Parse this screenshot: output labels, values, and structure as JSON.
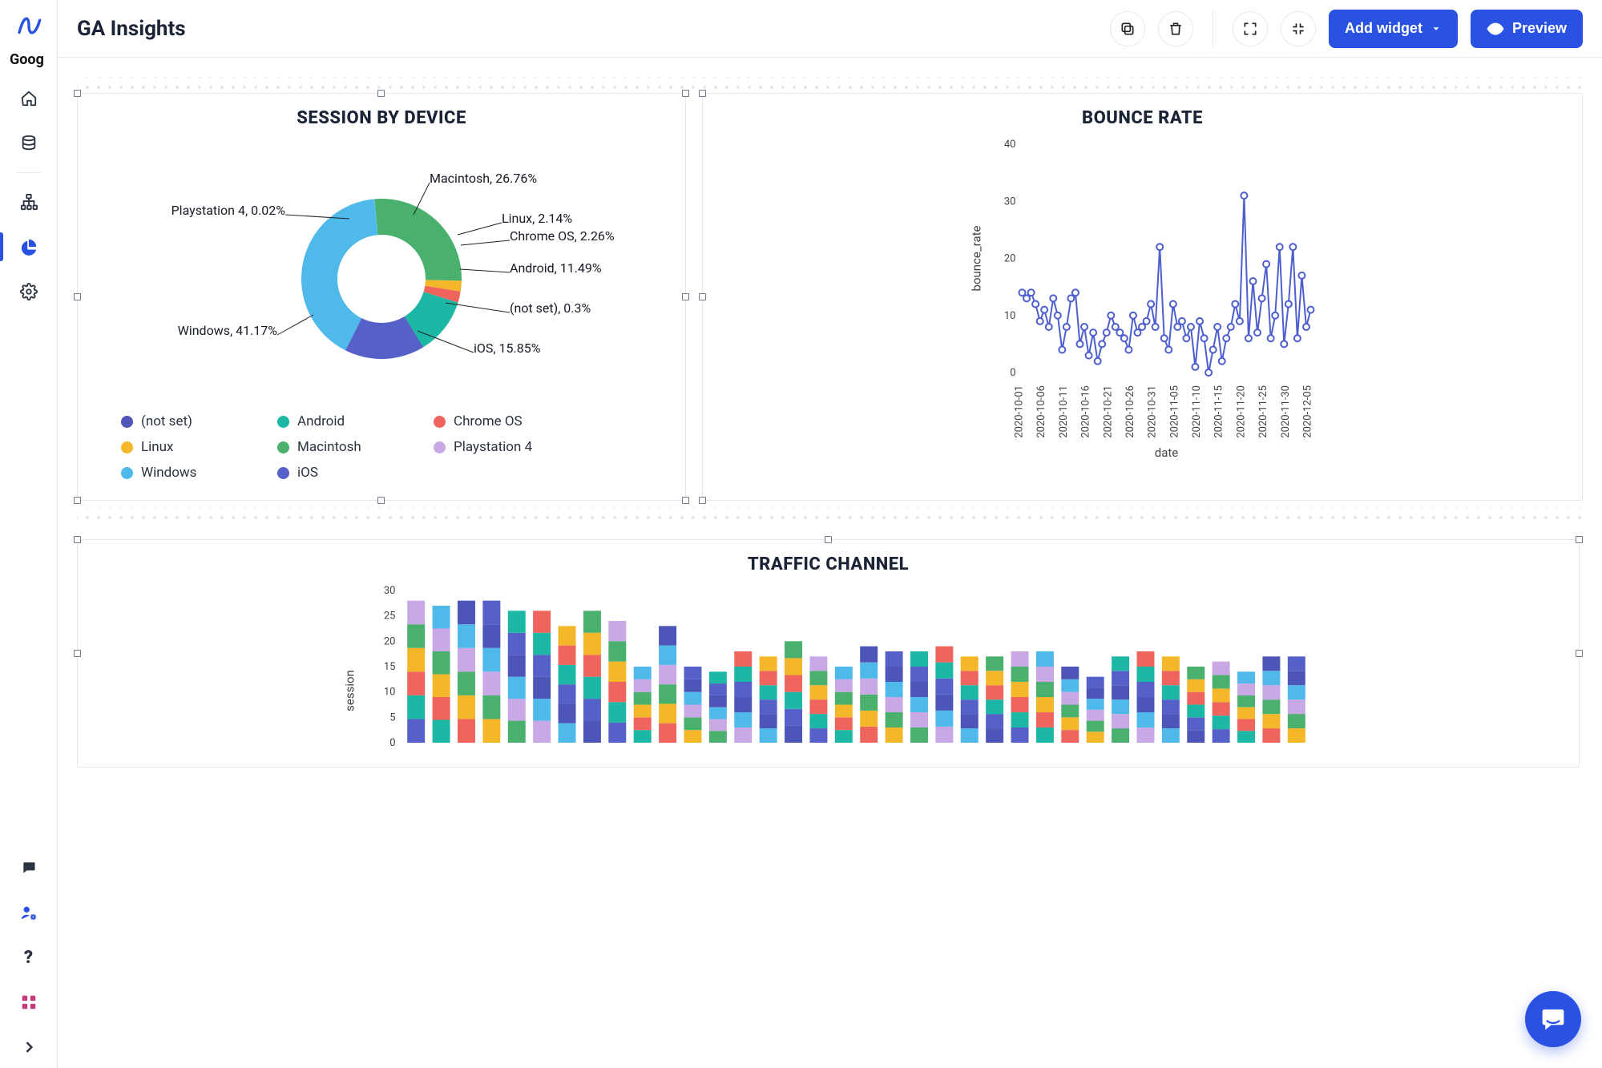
{
  "header": {
    "title": "GA Insights",
    "side_label": "Goog",
    "add_widget": "Add widget",
    "preview": "Preview"
  },
  "sidebar": {
    "items": [
      {
        "name": "home-icon"
      },
      {
        "name": "database-icon"
      },
      {
        "name": "sitemap-icon"
      },
      {
        "name": "pie-chart-icon",
        "active": true
      },
      {
        "name": "gear-icon"
      }
    ],
    "bottom": [
      {
        "name": "chat-icon"
      },
      {
        "name": "user-cog-icon"
      },
      {
        "name": "help-icon"
      },
      {
        "name": "grid-apps-icon"
      },
      {
        "name": "chevron-right-icon"
      }
    ]
  },
  "cards": {
    "session_by_device": {
      "title": "SESSION BY DEVICE"
    },
    "bounce_rate": {
      "title": "BOUNCE RATE",
      "xlabel": "date",
      "ylabel": "bounce_rate"
    },
    "traffic_channel": {
      "title": "TRAFFIC CHANNEL",
      "ylabel": "session"
    }
  },
  "legend_colors": {
    "(not set)": "#4e55b8",
    "Android": "#1cb8a5",
    "Chrome OS": "#f0645e",
    "Linux": "#f5b72a",
    "Macintosh": "#4ab06e",
    "Playstation 4": "#c9a8e6",
    "Windows": "#4fb9ea",
    "iOS": "#5560c9"
  },
  "pie_legend_order": [
    "(not set)",
    "Android",
    "Chrome OS",
    "Linux",
    "Macintosh",
    "Playstation 4",
    "Windows",
    "iOS"
  ],
  "pie_slice_labels": [
    "Macintosh, 26.76%",
    "Linux, 2.14%",
    "Chrome OS, 2.26%",
    "Android, 11.49%",
    "(not set), 0.3%",
    "iOS, 15.85%",
    "Windows, 41.17%",
    "Playstation 4, 0.02%"
  ],
  "chart_data": [
    {
      "type": "pie",
      "title": "SESSION BY DEVICE",
      "series": [
        {
          "name": "(not set)",
          "value": 0.3,
          "color": "#4e55b8"
        },
        {
          "name": "Android",
          "value": 11.49,
          "color": "#1cb8a5"
        },
        {
          "name": "Chrome OS",
          "value": 2.26,
          "color": "#f0645e"
        },
        {
          "name": "Linux",
          "value": 2.14,
          "color": "#f5b72a"
        },
        {
          "name": "Macintosh",
          "value": 26.76,
          "color": "#4ab06e"
        },
        {
          "name": "Playstation 4",
          "value": 0.02,
          "color": "#c9a8e6"
        },
        {
          "name": "Windows",
          "value": 41.17,
          "color": "#4fb9ea"
        },
        {
          "name": "iOS",
          "value": 15.85,
          "color": "#5560c9"
        }
      ]
    },
    {
      "type": "line",
      "title": "BOUNCE RATE",
      "xlabel": "date",
      "ylabel": "bounce_rate",
      "ylim": [
        0,
        40
      ],
      "yticks": [
        0,
        10,
        20,
        30,
        40
      ],
      "categories": [
        "2020-10-01",
        "2020-10-06",
        "2020-10-11",
        "2020-10-16",
        "2020-10-21",
        "2020-10-26",
        "2020-10-31",
        "2020-11-05",
        "2020-11-10",
        "2020-11-15",
        "2020-11-20",
        "2020-11-25",
        "2020-11-30",
        "2020-12-05"
      ],
      "values": [
        14,
        13,
        14,
        12,
        9,
        11,
        8,
        13,
        10,
        4,
        8,
        13,
        14,
        5,
        8,
        3,
        7,
        2,
        5,
        7,
        10,
        8,
        7,
        6,
        4,
        10,
        7,
        8,
        9,
        12,
        8,
        22,
        6,
        4,
        12,
        8,
        9,
        6,
        8,
        1,
        9,
        6,
        0,
        4,
        8,
        2,
        6,
        8,
        12,
        9,
        31,
        6,
        16,
        7,
        13,
        19,
        6,
        10,
        22,
        5,
        12,
        22,
        6,
        17,
        8,
        11
      ]
    },
    {
      "type": "bar",
      "title": "TRAFFIC CHANNEL",
      "ylabel": "session",
      "ylim": [
        0,
        30
      ],
      "yticks": [
        0,
        5,
        10,
        15,
        20,
        25,
        30
      ],
      "stacked": true,
      "categories_count": 36,
      "series_colors": [
        "#5560c9",
        "#1cb8a5",
        "#f0645e",
        "#f5b72a",
        "#4ab06e",
        "#c9a8e6",
        "#4fb9ea",
        "#4e55b8"
      ],
      "totals": [
        28,
        27,
        28,
        28,
        26,
        26,
        23,
        26,
        24,
        15,
        23,
        15,
        14,
        18,
        17,
        20,
        17,
        15,
        19,
        18,
        18,
        19,
        17,
        17,
        18,
        18,
        15,
        13,
        17,
        18,
        17,
        15,
        16,
        14,
        17,
        17
      ]
    }
  ]
}
